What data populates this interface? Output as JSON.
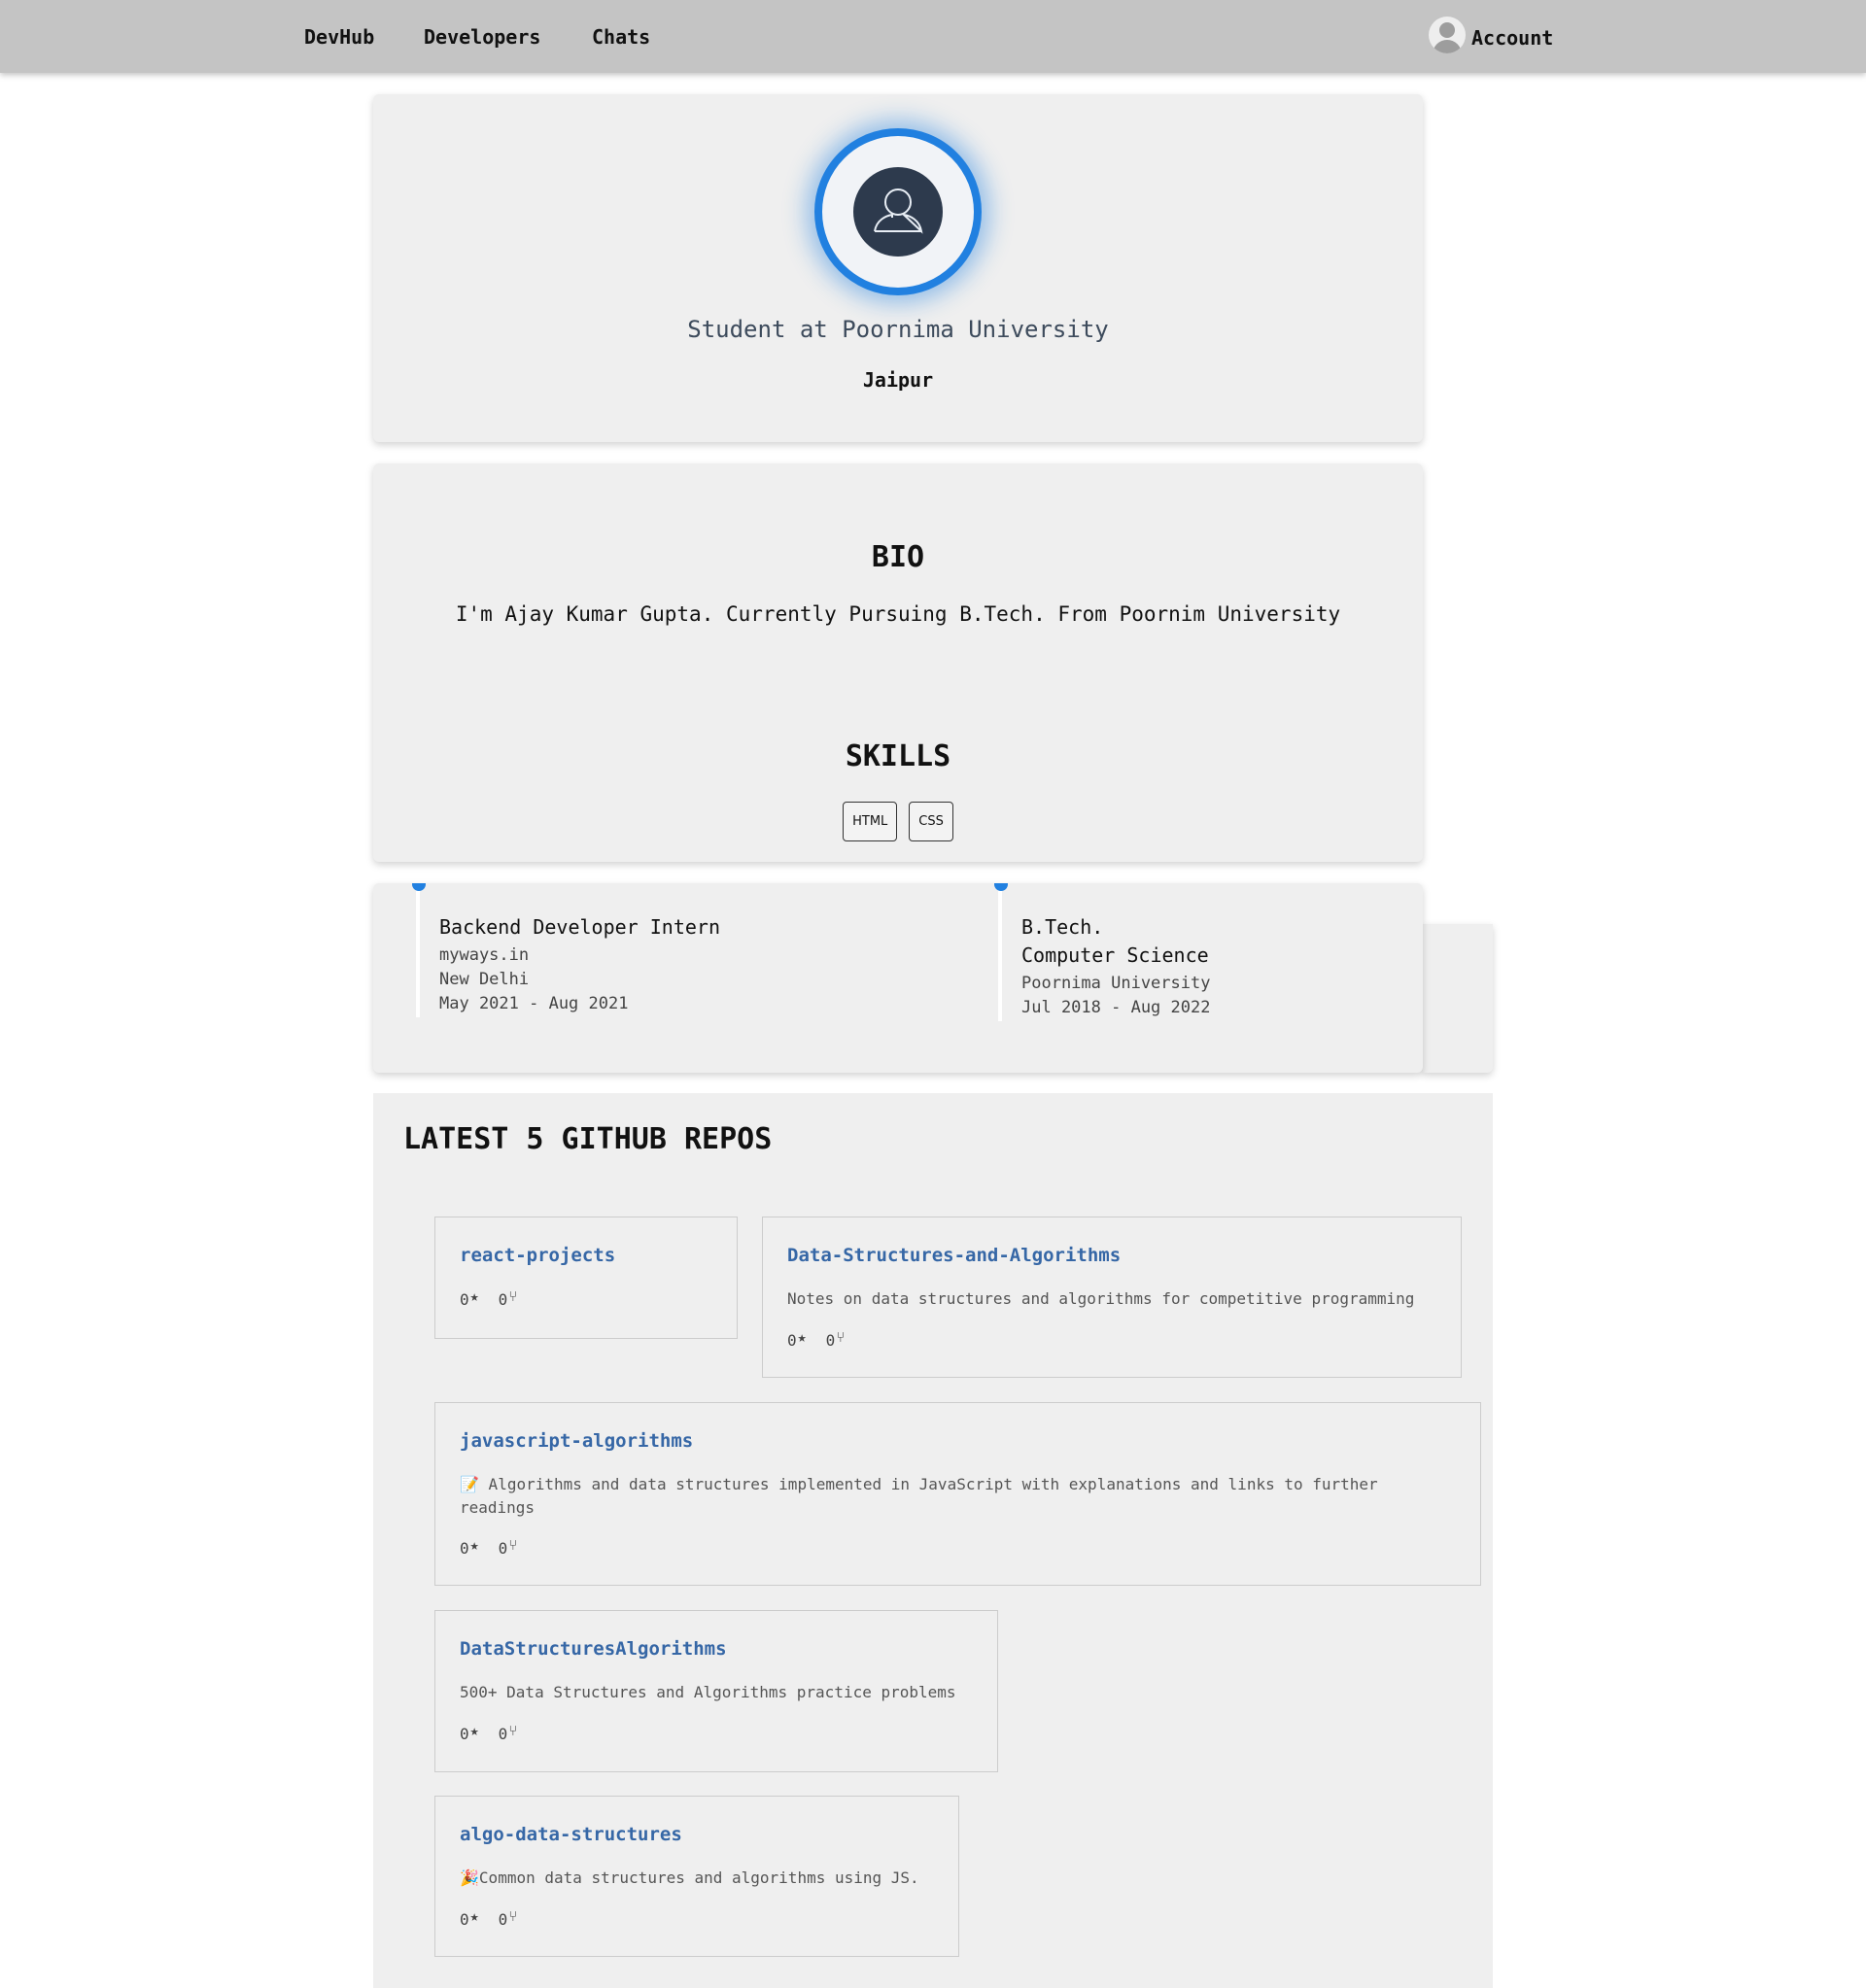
{
  "nav": {
    "brand": "DevHub",
    "developers": "Developers",
    "chats": "Chats",
    "account": "Account"
  },
  "profile": {
    "headline": "Student at Poornima University",
    "location": "Jaipur"
  },
  "bio": {
    "title": "BIO",
    "text": "I'm Ajay Kumar Gupta. Currently Pursuing B.Tech. From Poornim University"
  },
  "skills": {
    "title": "SKILLS",
    "items": [
      "HTML",
      "CSS"
    ]
  },
  "experience": {
    "title": "Backend Developer Intern",
    "company": "myways.in",
    "location": "New Delhi",
    "dates": "May 2021 - Aug 2021"
  },
  "education": {
    "degree": "B.Tech.",
    "field": "Computer Science",
    "school": "Poornima University",
    "dates": "Jul 2018 - Aug 2022"
  },
  "repos": {
    "title": "LATEST 5 GITHUB REPOS",
    "items": [
      {
        "name": "react-projects",
        "description": "",
        "stars": "0",
        "forks": "0"
      },
      {
        "name": "Data-Structures-and-Algorithms",
        "description": "Notes on data structures and algorithms for competitive programming",
        "stars": "0",
        "forks": "0"
      },
      {
        "name": "javascript-algorithms",
        "description": "📝 Algorithms and data structures implemented in JavaScript with explanations and links to further readings",
        "stars": "0",
        "forks": "0"
      },
      {
        "name": "DataStructuresAlgorithms",
        "description": "500+ Data Structures and Algorithms practice problems",
        "stars": "0",
        "forks": "0"
      },
      {
        "name": "algo-data-structures",
        "description": "🎉Common data structures and algorithms using JS.",
        "stars": "0",
        "forks": "0"
      }
    ]
  },
  "icons": {
    "star": "★",
    "fork": "⑂"
  },
  "colors": {
    "accent": "#2180e0",
    "repo_link": "#3667a6",
    "navbar": "#c4c4c4",
    "card": "#efefef"
  }
}
